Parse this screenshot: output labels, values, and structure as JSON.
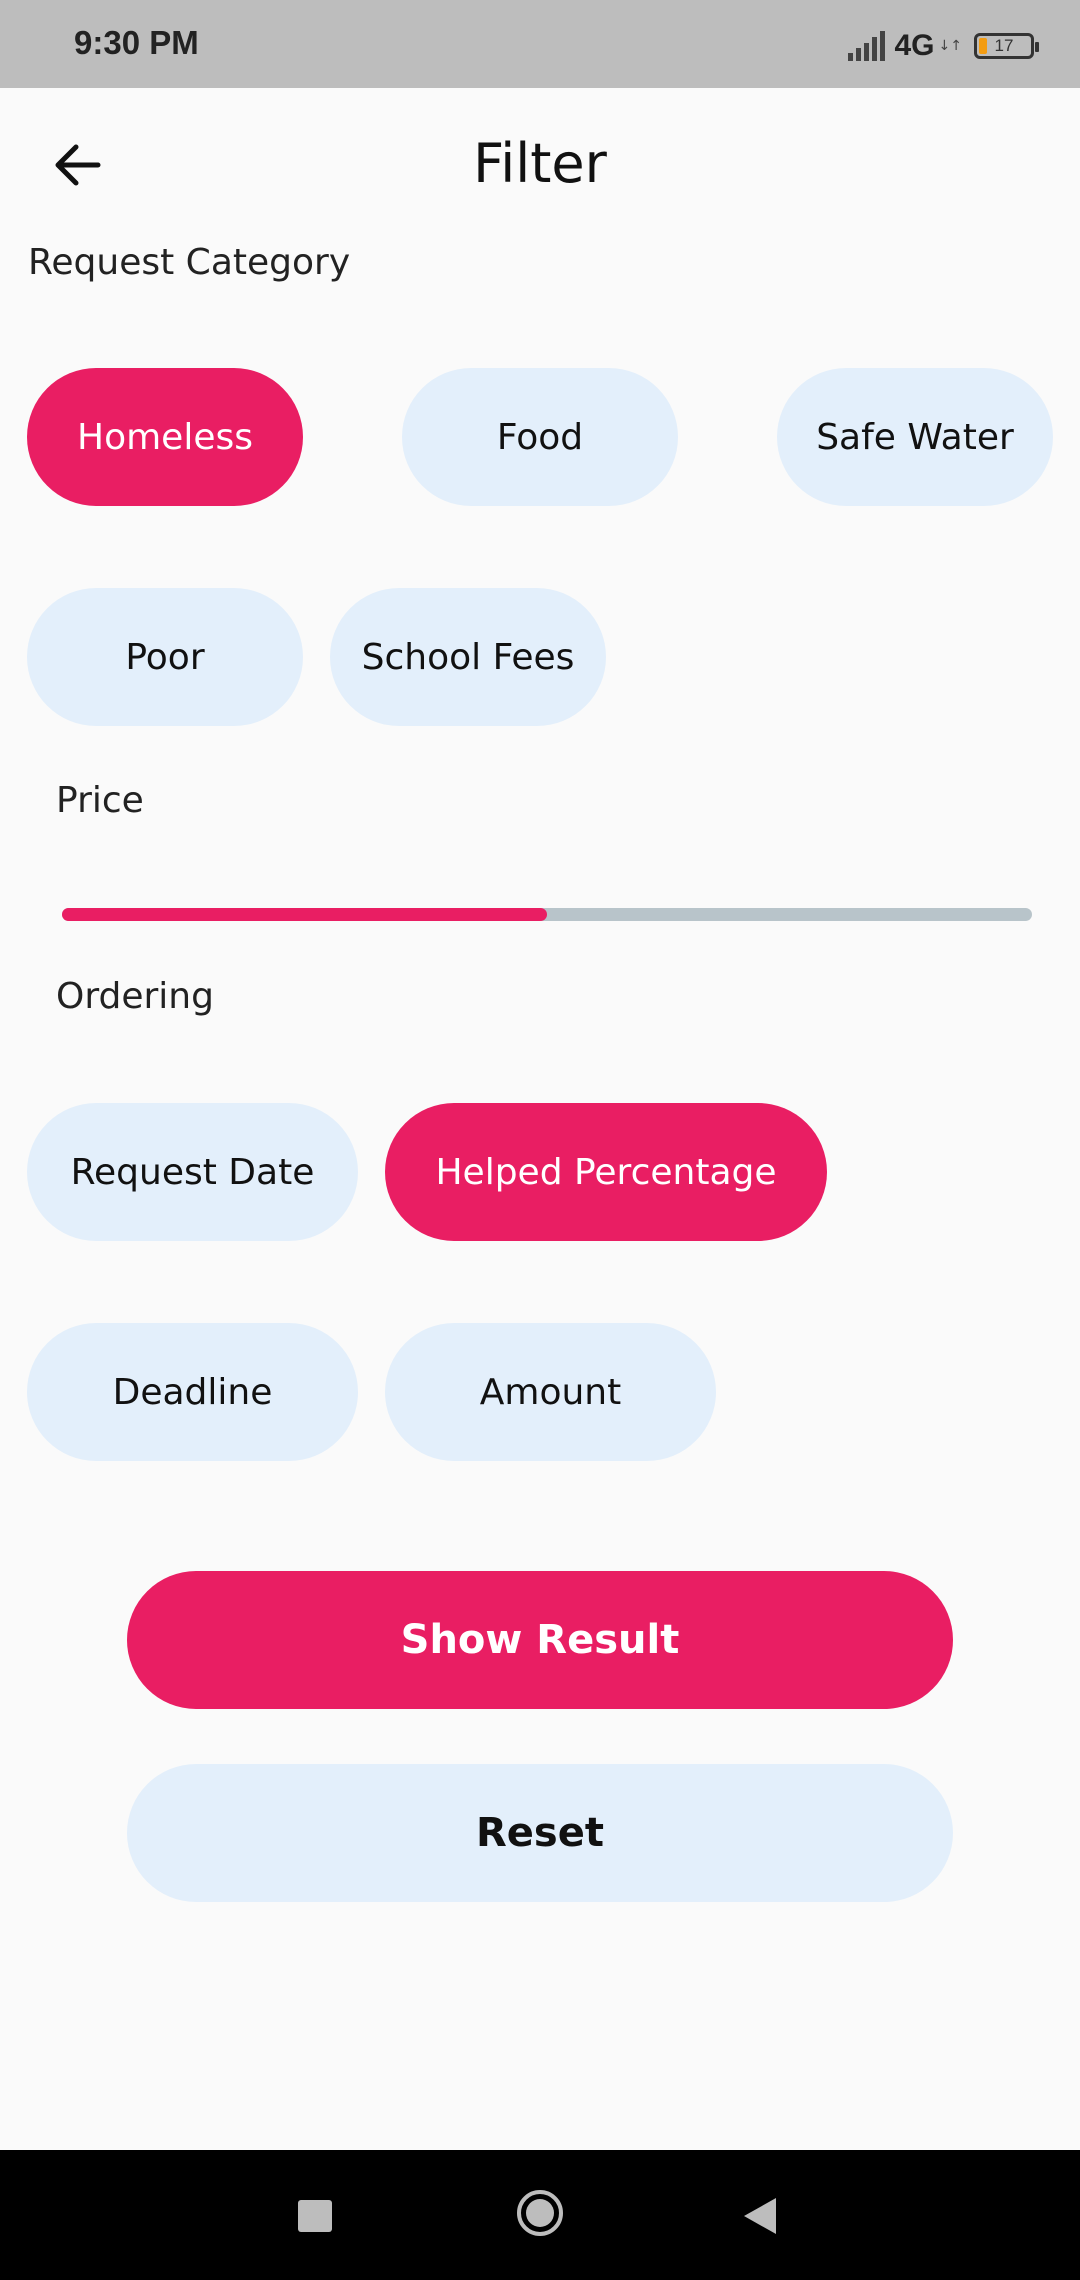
{
  "status_bar": {
    "time": "9:30 PM",
    "network": "4G",
    "battery": "17",
    "icons": [
      "signal-icon",
      "network-arrows-icon",
      "battery-icon"
    ]
  },
  "header": {
    "title": "Filter",
    "back_icon": "arrow-left-icon"
  },
  "request_category": {
    "label": "Request Category",
    "chips": [
      {
        "label": "Homeless",
        "selected": true
      },
      {
        "label": "Food",
        "selected": false
      },
      {
        "label": "Safe Water",
        "selected": false
      },
      {
        "label": "Poor",
        "selected": false
      },
      {
        "label": "School Fees",
        "selected": false
      }
    ]
  },
  "price": {
    "label": "Price",
    "slider_fraction": 0.5
  },
  "ordering": {
    "label": "Ordering",
    "chips": [
      {
        "label": "Request Date",
        "selected": false
      },
      {
        "label": "Helped Percentage",
        "selected": true
      },
      {
        "label": "Deadline",
        "selected": false
      },
      {
        "label": "Amount",
        "selected": false
      }
    ]
  },
  "actions": {
    "show_result": "Show Result",
    "reset": "Reset"
  },
  "nav_bar": {
    "icons": [
      "recents-square-icon",
      "home-circle-icon",
      "back-triangle-icon"
    ]
  },
  "colors": {
    "accent": "#e91e63",
    "chip_background": "#e3effb",
    "page_background": "#fafafa",
    "status_bar": "#bdbdbd",
    "slider_track": "#b8c4ca"
  }
}
